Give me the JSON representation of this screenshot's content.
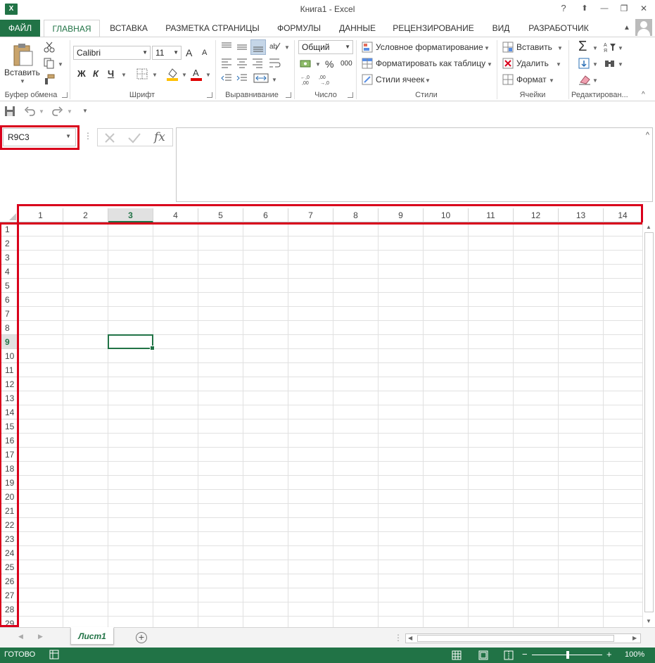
{
  "window": {
    "title": "Книга1 - Excel",
    "logo": "X",
    "help": "?",
    "restore_ribbon": "⬆",
    "minimize": "—",
    "maximize": "❐",
    "close": "✕"
  },
  "tabs": [
    {
      "label": "ФАЙЛ"
    },
    {
      "label": "ГЛАВНАЯ"
    },
    {
      "label": "ВСТАВКА"
    },
    {
      "label": "РАЗМЕТКА СТРАНИЦЫ"
    },
    {
      "label": "ФОРМУЛЫ"
    },
    {
      "label": "ДАННЫЕ"
    },
    {
      "label": "РЕЦЕНЗИРОВАНИЕ"
    },
    {
      "label": "ВИД"
    },
    {
      "label": "РАЗРАБОТЧИК"
    }
  ],
  "ribbon": {
    "clipboard": {
      "paste": "Вставить",
      "label": "Буфер обмена"
    },
    "font": {
      "name": "Calibri",
      "size": "11",
      "bold": "Ж",
      "italic": "К",
      "underline": "Ч",
      "grow": "A",
      "shrink": "A",
      "label": "Шрифт"
    },
    "alignment": {
      "label": "Выравнивание"
    },
    "number": {
      "format": "Общий",
      "percent": "%",
      "thousands": "000",
      "label": "Число"
    },
    "styles": {
      "conditional": "Условное форматирование",
      "as_table": "Форматировать как таблицу",
      "cell_styles": "Стили ячеек",
      "label": "Стили"
    },
    "cells": {
      "insert": "Вставить",
      "delete": "Удалить",
      "format": "Формат",
      "label": "Ячейки"
    },
    "editing": {
      "sum": "Σ",
      "label": "Редактирован..."
    }
  },
  "formula_bar": {
    "name_box": "R9C3",
    "fx": "fx",
    "value": ""
  },
  "grid": {
    "columns": [
      "1",
      "2",
      "3",
      "4",
      "5",
      "6",
      "7",
      "8",
      "9",
      "10",
      "11",
      "12",
      "13",
      "14"
    ],
    "rows": [
      "1",
      "2",
      "3",
      "4",
      "5",
      "6",
      "7",
      "8",
      "9",
      "10",
      "11",
      "12",
      "13",
      "14",
      "15",
      "16",
      "17",
      "18",
      "19",
      "20",
      "21",
      "22",
      "23",
      "24",
      "25",
      "26",
      "27",
      "28",
      "29"
    ],
    "selected_column": "3",
    "selected_row": "9"
  },
  "sheets": {
    "active": "Лист1",
    "add": "+"
  },
  "status": {
    "ready": "ГОТОВО",
    "zoom": "100%",
    "zoom_minus": "−",
    "zoom_plus": "+"
  },
  "colors": {
    "accent": "#217346",
    "highlight": "#d9001b"
  }
}
